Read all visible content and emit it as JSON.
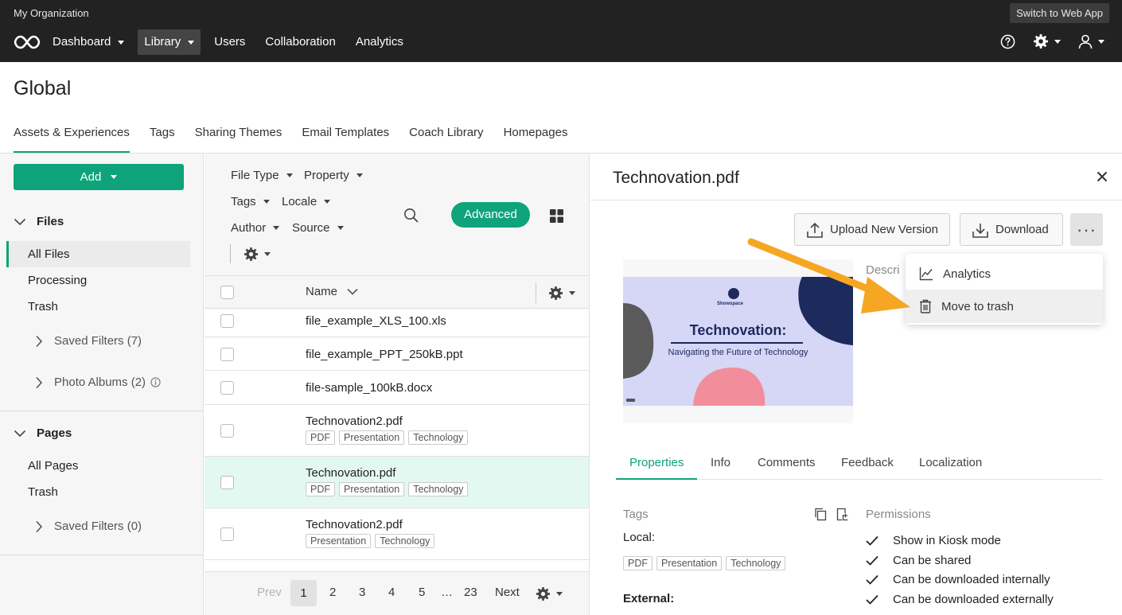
{
  "topbar": {
    "org": "My Organization",
    "switch_label": "Switch to Web App",
    "nav": [
      {
        "label": "Dashboard",
        "dropdown": true
      },
      {
        "label": "Library",
        "dropdown": true,
        "active": true
      },
      {
        "label": "Users",
        "dropdown": false
      },
      {
        "label": "Collaboration",
        "dropdown": false
      },
      {
        "label": "Analytics",
        "dropdown": false
      }
    ],
    "icons": [
      "help-icon",
      "gear-icon",
      "user-icon"
    ]
  },
  "header": {
    "title": "Global",
    "tabs": [
      "Assets & Experiences",
      "Tags",
      "Sharing Themes",
      "Email Templates",
      "Coach Library",
      "Homepages"
    ],
    "active_tab": 0
  },
  "sidebar": {
    "add_label": "Add",
    "files_heading": "Files",
    "files_items": [
      "All Files",
      "Processing",
      "Trash"
    ],
    "saved_filters": "Saved Filters (7)",
    "photo_albums": "Photo Albums (2)",
    "pages_heading": "Pages",
    "pages_items": [
      "All Pages",
      "Trash"
    ],
    "pages_saved_filters": "Saved Filters (0)"
  },
  "filters": {
    "file_type": "File Type",
    "property": "Property",
    "tags": "Tags",
    "locale": "Locale",
    "author": "Author",
    "source": "Source",
    "advanced": "Advanced"
  },
  "list": {
    "name_header": "Name",
    "rows": [
      {
        "name": "file_example_XLS_100.xls",
        "tags": []
      },
      {
        "name": "file_example_PPT_250kB.ppt",
        "tags": []
      },
      {
        "name": "file-sample_100kB.docx",
        "tags": []
      },
      {
        "name": "Technovation2.pdf",
        "tags": [
          "PDF",
          "Presentation",
          "Technology"
        ]
      },
      {
        "name": "Technovation.pdf",
        "tags": [
          "PDF",
          "Presentation",
          "Technology"
        ],
        "selected": true
      },
      {
        "name": "Technovation2.pdf",
        "tags": [
          "Presentation",
          "Technology"
        ]
      }
    ]
  },
  "pager": {
    "prev": "Prev",
    "pages": [
      "1",
      "2",
      "3",
      "4",
      "5"
    ],
    "ellipsis": "…",
    "last": "23",
    "next": "Next",
    "current": "1"
  },
  "detail": {
    "title": "Technovation.pdf",
    "upload_label": "Upload New Version",
    "download_label": "Download",
    "more_label": "···",
    "desc_peek": "Descri",
    "menu": [
      "Analytics",
      "Move to trash"
    ],
    "thumb": {
      "brand": "Showspace",
      "title": "Technovation:",
      "subtitle": "Navigating the Future of Technology"
    },
    "tabs": [
      "Properties",
      "Info",
      "Comments",
      "Feedback",
      "Localization"
    ],
    "active_tab": 0,
    "tags_label": "Tags",
    "local_label": "Local:",
    "local_tags": [
      "PDF",
      "Presentation",
      "Technology"
    ],
    "external_label": "External:",
    "permissions_label": "Permissions",
    "permissions": [
      "Show in Kiosk mode",
      "Can be shared",
      "Can be downloaded internally",
      "Can be downloaded externally"
    ]
  },
  "colors": {
    "accent": "#0fa37b",
    "topbar": "#222222",
    "selected_row": "#e3f8f1",
    "arrow": "#f5a623",
    "thumb_bg": "#d6d6f7",
    "thumb_navy": "#1d2a5c",
    "thumb_pink": "#f28e9b"
  }
}
